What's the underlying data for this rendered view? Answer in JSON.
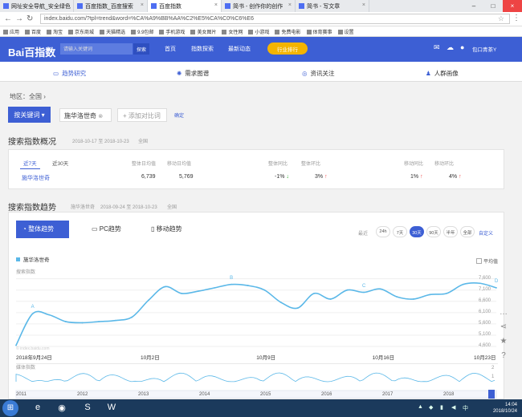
{
  "browser": {
    "tabs": [
      {
        "title": "网址安全导航_安全绿色"
      },
      {
        "title": "百度指数_百度搜索"
      },
      {
        "title": "百度指数"
      },
      {
        "title": "简书 - 创作你的创作"
      },
      {
        "title": "简书 - 写文章"
      }
    ],
    "url": "index.baidu.com/?tpl=trend&word=%CA%A9%BB%AA%C2%E5%CA%C0%C6%E6",
    "bookmarks": [
      "应用",
      "百度",
      "淘宝",
      "京东商城",
      "天猫精选",
      "9.9包邮",
      "手机游戏",
      "美女图片",
      "女性网",
      "小游戏",
      "免费电影",
      "体育赛事",
      "设置"
    ]
  },
  "header": {
    "logo": "Bai百指数",
    "search_placeholder": "请输入关键词",
    "search_button": "探索",
    "menu": [
      "首页",
      "指数探索",
      "最新动态"
    ],
    "industry_button": "行业排行",
    "user": "包口青茶Y"
  },
  "subnav": [
    "趋势研究",
    "需求图谱",
    "资讯关注",
    "人群画像"
  ],
  "filters": {
    "region": "地区：全国",
    "keyword_button": "按关键词",
    "keyword": "施华洛世奇",
    "add_compare": "+ 添加对比词",
    "confirm": "确定"
  },
  "overview": {
    "title": "搜索指数概况",
    "date_range": "2018-10-17 至 2018-10-23",
    "scope": "全国",
    "range_tabs": [
      "近7天",
      "近30天"
    ],
    "headers": [
      "整体日均值",
      "移动日均值",
      "整体同比",
      "整体环比",
      "移动同比",
      "移动环比"
    ],
    "keyword": "施华洛世奇",
    "overall_avg": "6,739",
    "mobile_avg": "5,769",
    "overall_yoy": "-1%",
    "overall_mom": "3%",
    "mobile_yoy": "1%",
    "mobile_mom": "4%"
  },
  "trend": {
    "title": "搜索指数趋势",
    "keyword": "施华洛世奇",
    "date_range": "2018-09-24 至 2018-10-23",
    "scope": "全国",
    "modes": [
      "整体趋势",
      "PC趋势",
      "移动趋势"
    ],
    "range_label": "最近",
    "ranges": [
      "24h",
      "7天",
      "30天",
      "90天",
      "半年",
      "全部"
    ],
    "active_range": "30天",
    "custom": "自定义",
    "avg_label": "平均值",
    "ylabel": "搜索指数",
    "watermark": "© index.baidu.com",
    "mini_label": "媒体指数",
    "mini_ticks": [
      "2",
      "1"
    ],
    "years": [
      "2011",
      "2012",
      "2013",
      "2014",
      "2015",
      "2016",
      "2017",
      "2018"
    ]
  },
  "chart_data": {
    "type": "line",
    "title": "",
    "xlabel": "",
    "ylabel": "搜索指数",
    "x_ticks": [
      "2018年9月24日",
      "10月2日",
      "10月9日",
      "10月16日",
      "10月23日"
    ],
    "y_ticks": [
      4600,
      5100,
      5600,
      6100,
      6600,
      7100,
      7600
    ],
    "ylim": [
      4600,
      7800
    ],
    "series": [
      {
        "name": "施华洛世奇",
        "color": "#5bb8e8",
        "x": [
          "2018-09-24",
          "2018-09-25",
          "2018-09-26",
          "2018-09-27",
          "2018-09-28",
          "2018-09-29",
          "2018-09-30",
          "2018-10-01",
          "2018-10-02",
          "2018-10-03",
          "2018-10-04",
          "2018-10-05",
          "2018-10-06",
          "2018-10-07",
          "2018-10-08",
          "2018-10-09",
          "2018-10-10",
          "2018-10-11",
          "2018-10-12",
          "2018-10-13",
          "2018-10-14",
          "2018-10-15",
          "2018-10-16",
          "2018-10-17",
          "2018-10-18",
          "2018-10-19",
          "2018-10-20",
          "2018-10-21",
          "2018-10-22",
          "2018-10-23"
        ],
        "values": [
          4650,
          6050,
          6000,
          5700,
          5650,
          5700,
          5750,
          5900,
          6650,
          7250,
          6950,
          7050,
          7200,
          7350,
          7300,
          7100,
          6550,
          6300,
          6950,
          6700,
          7100,
          7000,
          7150,
          6800,
          6700,
          6900,
          6950,
          7350,
          7400,
          7200
        ]
      }
    ],
    "markers": [
      "A",
      "B",
      "C",
      "D"
    ],
    "grid": true,
    "legend": "top-left"
  },
  "taskbar": {
    "time": "14:04",
    "date": "2018/10/24"
  }
}
